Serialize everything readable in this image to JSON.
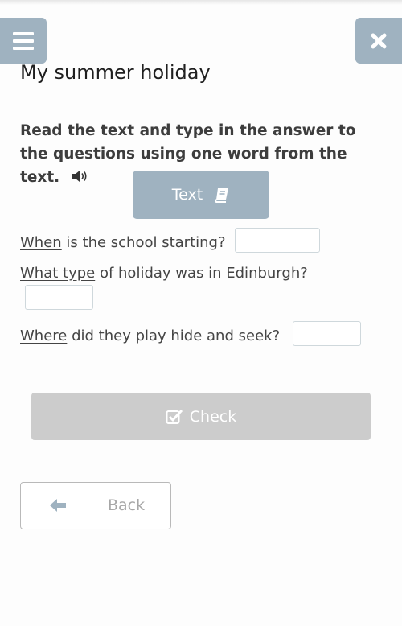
{
  "header": {
    "menu_icon": "hamburger-icon",
    "close_icon": "close-icon",
    "title": "My summer holiday"
  },
  "instructions": {
    "text": "Read the text and type in the answer to the questions using one word from the text.",
    "audio_icon": "speaker-icon"
  },
  "text_button": {
    "label": "Text",
    "icon": "book-icon"
  },
  "questions": [
    {
      "keyword": "When",
      "rest": " is the school starting?",
      "answer_value": "",
      "answer_placeholder": ""
    },
    {
      "keyword": "What type",
      "rest": " of holiday was in Edinburgh?",
      "answer_value": "",
      "answer_placeholder": ""
    },
    {
      "keyword": "Where",
      "rest": " did they play hide and seek?",
      "answer_value": "",
      "answer_placeholder": ""
    }
  ],
  "check_button": {
    "label": "Check",
    "icon": "checkbox-icon"
  },
  "back_button": {
    "label": "Back",
    "icon": "arrow-left-icon"
  },
  "colors": {
    "accent": "#9fb2c0",
    "disabled": "#cccccc",
    "text": "#444444"
  }
}
